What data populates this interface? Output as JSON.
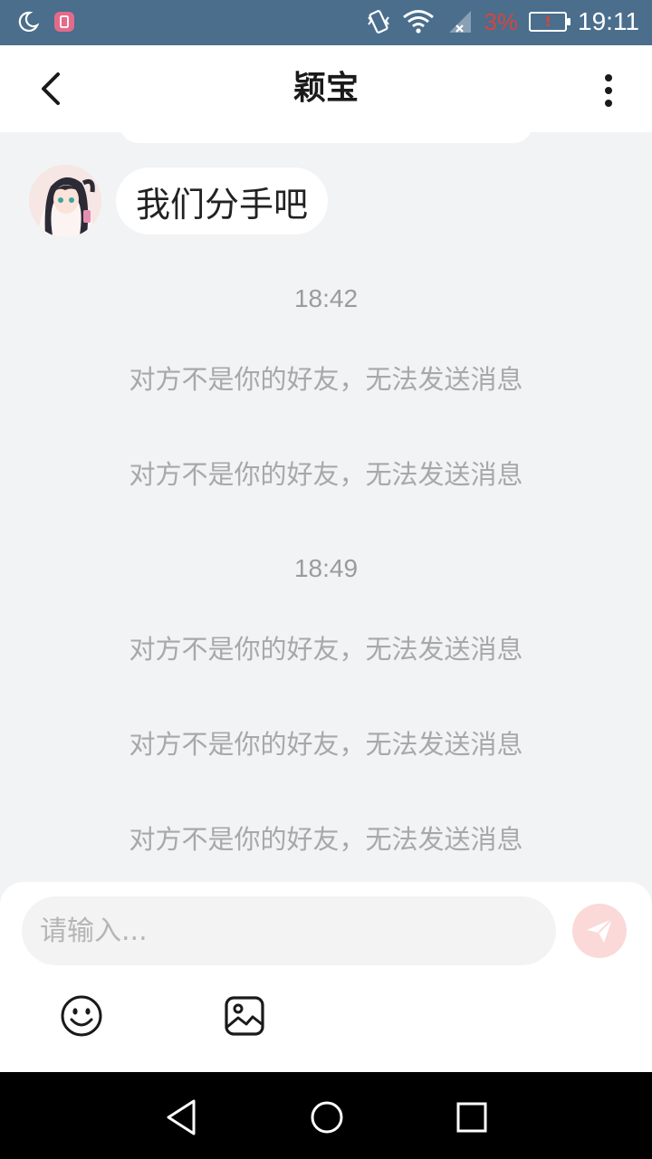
{
  "status_bar": {
    "time": "19:11",
    "battery_percent": "3%",
    "battery_warning": "!",
    "icons": [
      "moon-icon",
      "app-notification-icon",
      "vibrate-icon",
      "wifi-icon",
      "signal-icon",
      "battery-icon"
    ]
  },
  "header": {
    "title": "颖宝",
    "back_icon": "chevron-left-icon",
    "menu_icon": "more-vertical-icon"
  },
  "messages": {
    "incoming": {
      "text": "我们分手吧",
      "avatar": "anime-girl-avatar"
    },
    "time_1": "18:42",
    "notice_1": "对方不是你的好友，无法发送消息",
    "notice_2": "对方不是你的好友，无法发送消息",
    "time_2": "18:49",
    "notice_3": "对方不是你的好友，无法发送消息",
    "notice_4": "对方不是你的好友，无法发送消息",
    "notice_5": "对方不是你的好友，无法发送消息"
  },
  "composer": {
    "placeholder": "请输入...",
    "value": "",
    "send_icon": "send-icon",
    "emoji_icon": "emoji-icon",
    "image_icon": "image-icon"
  },
  "colors": {
    "status_bar": "#4a6e8c",
    "background": "#f2f3f5",
    "send_button": "#fbd9d9",
    "battery_low": "#d8443e"
  }
}
